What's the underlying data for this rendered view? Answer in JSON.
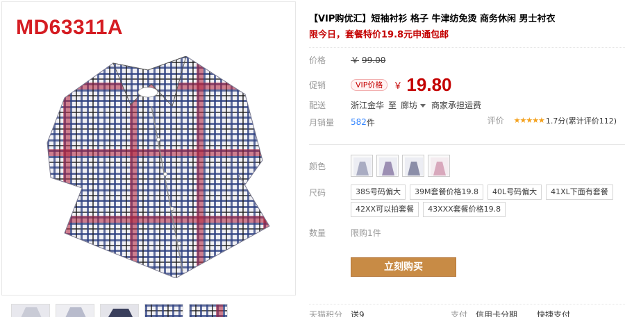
{
  "gallery": {
    "model_code": "MD63311A",
    "thumb_count": 5
  },
  "product": {
    "title_tag": "【VIP购优汇】",
    "title": "短袖衬衫 格子 牛津纺免烫 商务休闲 男士衬衣",
    "promo": "限今日，套餐特价19.8元申通包邮"
  },
  "price": {
    "label": "价格",
    "currency": "￥",
    "original": "99.00",
    "promo_label": "促销",
    "vip_tag": "VIP价格",
    "promo_price": "19.80"
  },
  "shipping": {
    "label": "配送",
    "from": "浙江金华",
    "to_word": "至",
    "to": "廊坊",
    "fee": "商家承担运费"
  },
  "sales": {
    "label": "月销量",
    "count": "582",
    "unit": "件",
    "rating_label": "评价",
    "stars": "★★★★★",
    "rating_text": "1.7分(累计评价112)"
  },
  "options": {
    "color_label": "颜色",
    "size_label": "尺码",
    "sizes": [
      "38S号码偏大",
      "39M套餐价格19.8",
      "40L号码偏大",
      "41XL下面有套餐",
      "42XX可以拍套餐",
      "43XXX套餐价格19.8"
    ],
    "qty_label": "数量",
    "qty_limit": "限购1件"
  },
  "buy": {
    "label": "立刻购买"
  },
  "bottom": {
    "points_label": "天猫积分",
    "points_value": "送9",
    "pay_label": "支付",
    "pay_value1": "信用卡分期",
    "pay_value2": "快捷支付"
  },
  "colors": {
    "accent": "#c40000",
    "buy": "#c88b45",
    "shirt_navy": "#2c3e80",
    "shirt_red": "#b0213a",
    "shirt_white": "#f2f2f2"
  }
}
